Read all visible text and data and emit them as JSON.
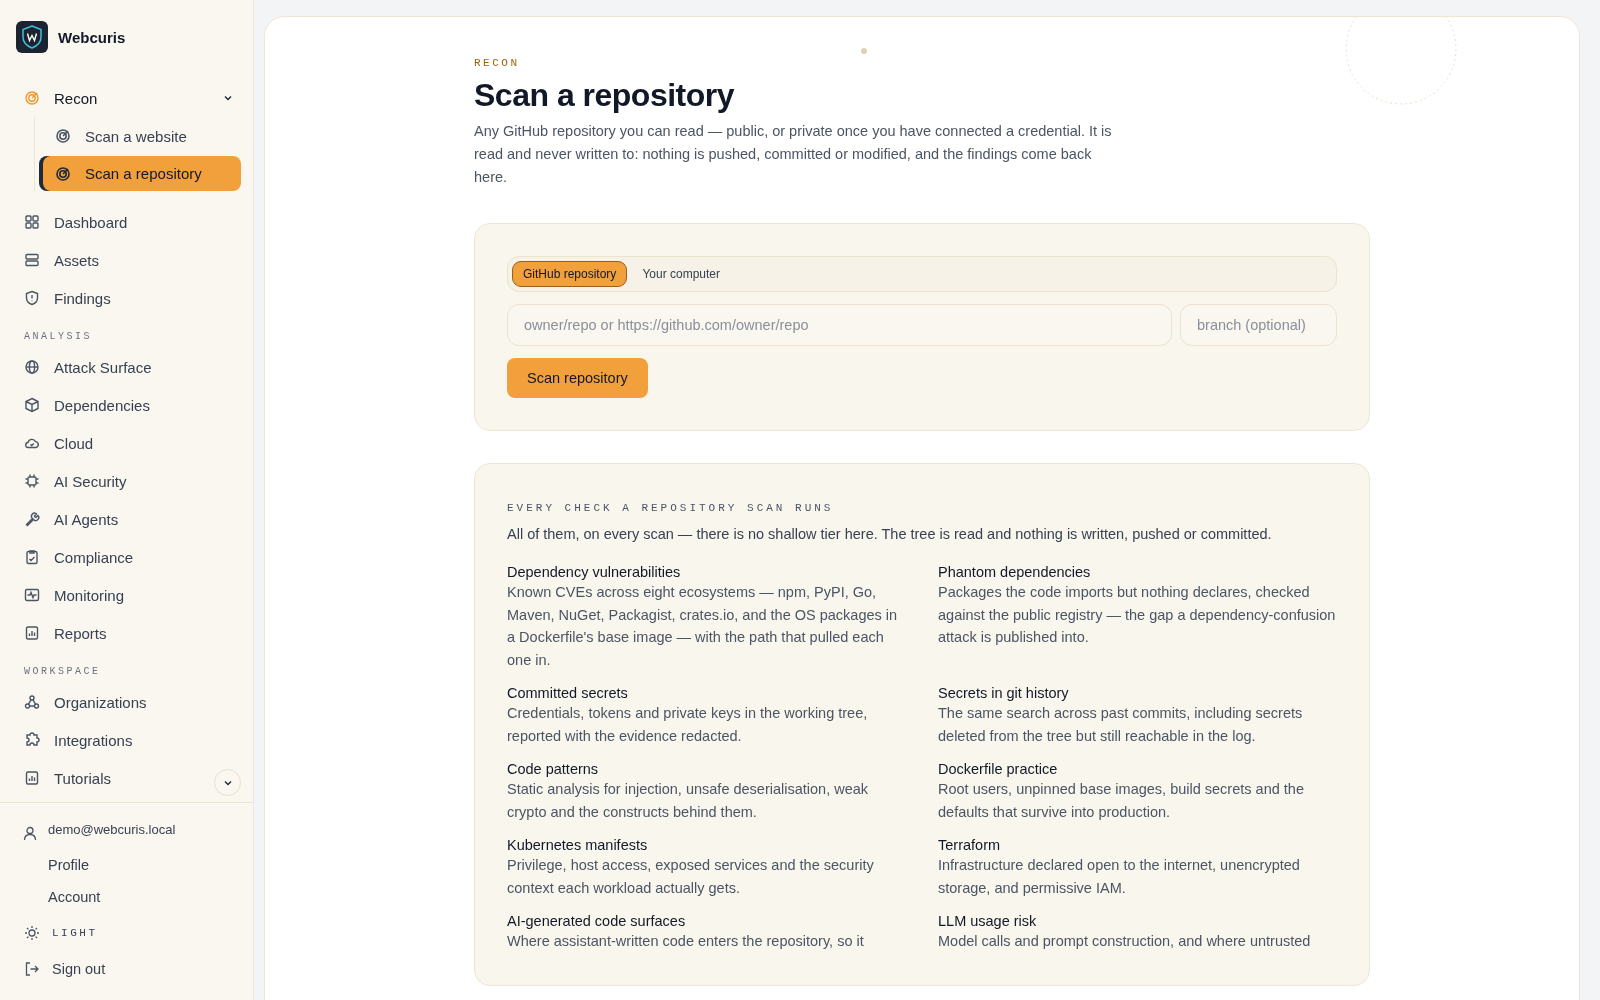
{
  "brand": {
    "name": "Webcuris"
  },
  "sidebar": {
    "groups": [
      {
        "items": [
          {
            "label": "Recon",
            "expanded": true,
            "selected": false,
            "children": [
              {
                "label": "Scan a website",
                "selected": false
              },
              {
                "label": "Scan a repository",
                "selected": true
              }
            ]
          },
          {
            "label": "Dashboard",
            "selected": false
          },
          {
            "label": "Assets",
            "selected": false
          },
          {
            "label": "Findings",
            "selected": false
          }
        ]
      },
      {
        "heading": "ANALYSIS",
        "items": [
          {
            "label": "Attack Surface",
            "selected": false
          },
          {
            "label": "Dependencies",
            "selected": false
          },
          {
            "label": "Cloud",
            "selected": false
          },
          {
            "label": "AI Security",
            "selected": false
          },
          {
            "label": "AI Agents",
            "selected": false
          },
          {
            "label": "Compliance",
            "selected": false
          },
          {
            "label": "Monitoring",
            "selected": false
          },
          {
            "label": "Reports",
            "selected": false
          }
        ]
      },
      {
        "heading": "WORKSPACE",
        "items": [
          {
            "label": "Organizations",
            "selected": false
          },
          {
            "label": "Integrations",
            "selected": false
          },
          {
            "label": "Tutorials",
            "selected": false
          }
        ]
      }
    ],
    "account": {
      "email": "demo@webcuris.local",
      "links": [
        "Profile",
        "Account"
      ]
    },
    "theme": "LIGHT",
    "sign_out": "Sign out"
  },
  "header": {
    "eyebrow": "RECON",
    "title": "Scan a repository",
    "intro": "Any GitHub repository you can read — public, or private once you have connected a credential. It is read and never written to: nothing is pushed, committed or modified, and the findings come back here."
  },
  "form": {
    "sources": [
      {
        "label": "GitHub repository",
        "selected": true
      },
      {
        "label": "Your computer",
        "selected": false
      }
    ],
    "repo_placeholder": "owner/repo or https://github.com/owner/repo",
    "branch_placeholder": "branch (optional)",
    "submit": "Scan repository"
  },
  "checks": {
    "heading": "EVERY CHECK A REPOSITORY SCAN RUNS",
    "intro": "All of them, on every scan — there is no shallow tier here. The tree is read and nothing is written, pushed or committed.",
    "items": [
      {
        "title": "Dependency vulnerabilities",
        "text": "Known CVEs across eight ecosystems — npm, PyPI, Go, Maven, NuGet, Packagist, crates.io, and the OS packages in a Dockerfile's base image — with the path that pulled each one in."
      },
      {
        "title": "Phantom dependencies",
        "text": "Packages the code imports but nothing declares, checked against the public registry — the gap a dependency-confusion attack is published into."
      },
      {
        "title": "Committed secrets",
        "text": "Credentials, tokens and private keys in the working tree, reported with the evidence redacted."
      },
      {
        "title": "Secrets in git history",
        "text": "The same search across past commits, including secrets deleted from the tree but still reachable in the log."
      },
      {
        "title": "Code patterns",
        "text": "Static analysis for injection, unsafe deserialisation, weak crypto and the constructs behind them."
      },
      {
        "title": "Dockerfile practice",
        "text": "Root users, unpinned base images, build secrets and the defaults that survive into production."
      },
      {
        "title": "Kubernetes manifests",
        "text": "Privilege, host access, exposed services and the security context each workload actually gets."
      },
      {
        "title": "Terraform",
        "text": "Infrastructure declared open to the internet, unencrypted storage, and permissive IAM."
      },
      {
        "title": "AI-generated code surfaces",
        "text": "Where assistant-written code enters the repository, so it"
      },
      {
        "title": "LLM usage risk",
        "text": "Model calls and prompt construction, and where untrusted"
      }
    ]
  }
}
